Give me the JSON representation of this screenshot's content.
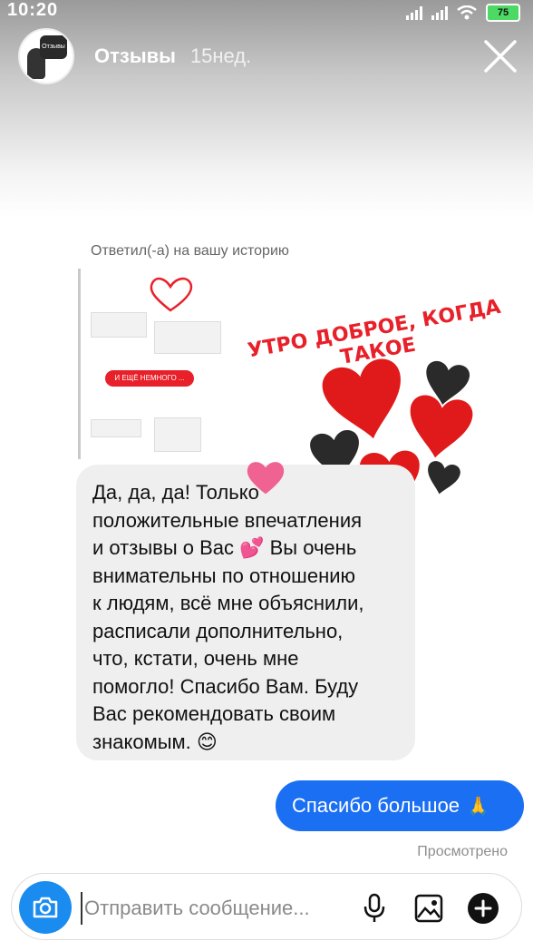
{
  "status_bar": {
    "time": "10:20",
    "battery": "75"
  },
  "story": {
    "username": "Отзывы",
    "time_ago": "15нед.",
    "avatar_text": "Отзывы"
  },
  "reply": {
    "caption": "Ответил(-а) на вашу историю",
    "thumb_button": "И ЕЩЁ НЕМНОГО ...",
    "sticker_text": "УТРО ДОБРОЕ, КОГДА ТАКОЕ"
  },
  "messages": {
    "received": "Да, да, да! Только\nположительные впечатления\nи отзывы о Вас 💕 Вы очень\nвнимательны по отношению\nк людям, всё мне объяснили,\nрасписали дополнительно,\nчто, кстати, очень мне\nпомогло! Спасибо Вам. Буду\nВас рекомендовать своим\nзнакомым. 😊",
    "sent": "Спасибо большое",
    "sent_emoji": "🙏",
    "seen": "Просмотрено"
  },
  "composer": {
    "placeholder": "Отправить сообщение..."
  },
  "colors": {
    "accent_blue": "#1a6ff2",
    "heart_red": "#e8202a"
  }
}
